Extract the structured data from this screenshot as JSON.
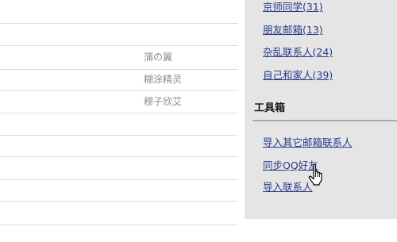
{
  "contacts": {
    "nicknames": [
      "蒲の翼",
      "糊涂精灵",
      "穆子欣艾"
    ]
  },
  "sidebar": {
    "groups": [
      {
        "label": "京师同学(31)"
      },
      {
        "label": "朋友邮箱(13)"
      },
      {
        "label": "杂乱联系人(24)"
      },
      {
        "label": "自己和家人(39)"
      }
    ],
    "toolbox": {
      "title": "工具箱",
      "items": [
        {
          "label": "导入其它邮箱联系人"
        },
        {
          "label": "同步QQ好友"
        },
        {
          "label": "导入联系人"
        }
      ]
    }
  },
  "colors": {
    "link": "#2a3a8a",
    "sidebar_bg": "#e5e5e5",
    "nickname": "#8c8c8c"
  },
  "cursor": {
    "icon": "hand-pointer-icon"
  }
}
